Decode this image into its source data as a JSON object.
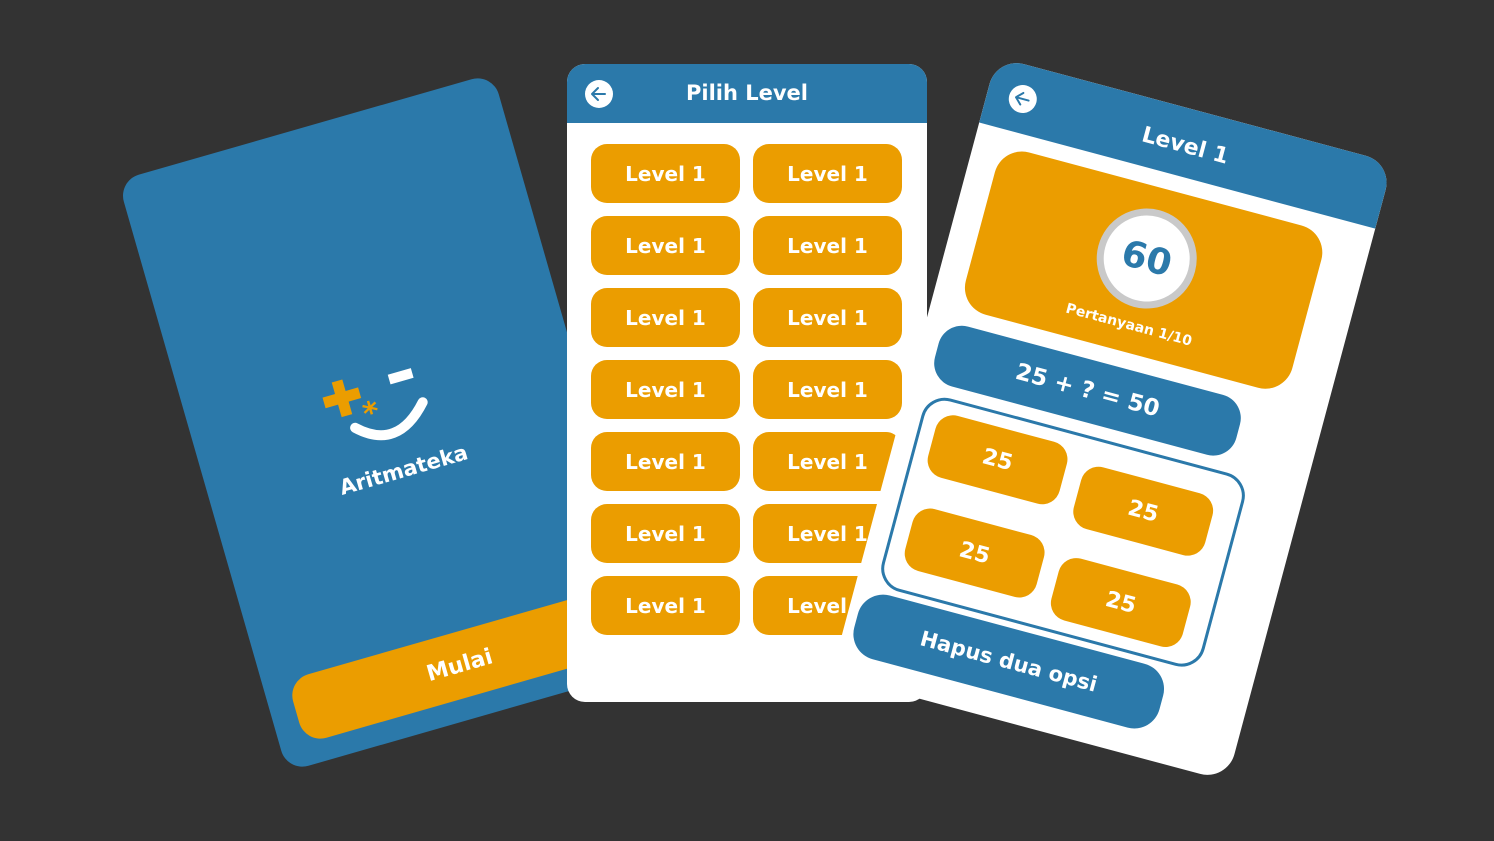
{
  "colors": {
    "background": "#333333",
    "primary": "#2b79aa",
    "accent": "#eb9d00",
    "surface": "#ffffff",
    "ring": "#c9c9c9"
  },
  "splash": {
    "logo_icon": "plus-asterisk-minus-smile-icon",
    "app_name": "Aritmateka",
    "start_label": "Mulai"
  },
  "level_select": {
    "back_icon": "arrow-left-icon",
    "title": "Pilih Level",
    "levels": [
      "Level 1",
      "Level 1",
      "Level 1",
      "Level 1",
      "Level 1",
      "Level 1",
      "Level 1",
      "Level 1",
      "Level 1",
      "Level 1",
      "Level 1",
      "Level 1",
      "Level 1",
      "Level 1"
    ]
  },
  "quiz": {
    "back_icon": "arrow-left-icon",
    "title": "Level 1",
    "timer": "60",
    "question_count": "Pertanyaan 1/10",
    "question": "25 + ? = 50",
    "options": [
      "25",
      "25",
      "25",
      "25"
    ],
    "hint_label": "Hapus dua opsi"
  }
}
